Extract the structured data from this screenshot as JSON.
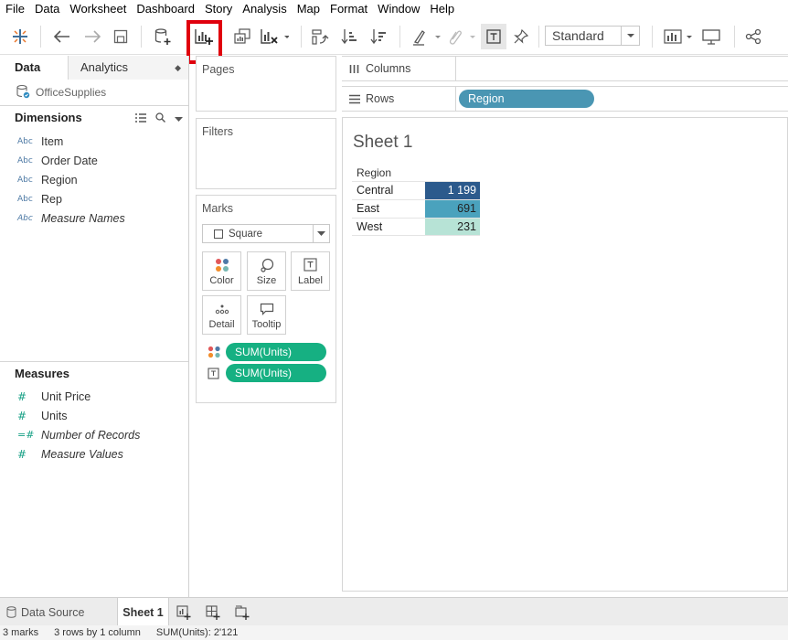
{
  "menu": [
    "File",
    "Data",
    "Worksheet",
    "Dashboard",
    "Story",
    "Analysis",
    "Map",
    "Format",
    "Window",
    "Help"
  ],
  "toolbar": {
    "fit_select": "Standard",
    "icons": [
      "tableau-logo-icon",
      "undo-icon",
      "redo-icon",
      "save-icon",
      "new-data-source-icon",
      "new-worksheet-icon",
      "duplicate-sheet-icon",
      "clear-sheet-icon",
      "swap-icon",
      "sort-ascending-icon",
      "sort-descending-icon",
      "highlight-icon",
      "group-icon",
      "label-icon",
      "pin-icon",
      "show-me-icon",
      "presentation-icon",
      "share-icon"
    ]
  },
  "data_pane": {
    "tab_data": "Data",
    "tab_analytics": "Analytics",
    "datasource": "OfficeSupplies",
    "dimensions_title": "Dimensions",
    "dimensions": [
      {
        "type": "Abc",
        "name": "Item",
        "italic": false
      },
      {
        "type": "Abc",
        "name": "Order Date",
        "italic": false
      },
      {
        "type": "Abc",
        "name": "Region",
        "italic": false
      },
      {
        "type": "Abc",
        "name": "Rep",
        "italic": false
      },
      {
        "type": "Abc",
        "name": "Measure Names",
        "italic": true
      }
    ],
    "measures_title": "Measures",
    "measures": [
      {
        "type": "#",
        "name": "Unit Price",
        "italic": false
      },
      {
        "type": "#",
        "name": "Units",
        "italic": false
      },
      {
        "type": "=#",
        "name": "Number of Records",
        "italic": true
      },
      {
        "type": "#",
        "name": "Measure Values",
        "italic": true
      }
    ]
  },
  "cards": {
    "pages": "Pages",
    "filters": "Filters",
    "marks": "Marks",
    "mark_type": "Square",
    "buttons": {
      "color": "Color",
      "size": "Size",
      "label": "Label",
      "detail": "Detail",
      "tooltip": "Tooltip"
    },
    "pills": [
      "SUM(Units)",
      "SUM(Units)"
    ]
  },
  "shelves": {
    "columns": "Columns",
    "rows": "Rows",
    "rows_pill": "Region"
  },
  "view": {
    "sheet_title": "Sheet 1",
    "header": "Region",
    "rows": [
      {
        "region": "Central",
        "value": "1 199",
        "color": "#2c5a8c",
        "text_color": "#ffffff"
      },
      {
        "region": "East",
        "value": "691",
        "color": "#4aa2bd",
        "text_color": "#222222"
      },
      {
        "region": "West",
        "value": "231",
        "color": "#b7e3d6",
        "text_color": "#222222"
      }
    ]
  },
  "bottom": {
    "data_source": "Data Source",
    "sheet_tab": "Sheet 1"
  },
  "status": {
    "marks": "3 marks",
    "dims": "3 rows by 1 column",
    "sum": "SUM(Units): 2'121"
  }
}
